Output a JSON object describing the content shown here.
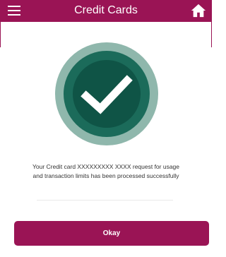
{
  "header": {
    "title": "Credit Cards",
    "menu_icon": "hamburger-menu-icon",
    "home_icon": "home-icon"
  },
  "result": {
    "icon": "checkmark-icon",
    "message": "Your Credit card XXXXXXXXX XXXX request for usage and transaction limits has been processed successfully"
  },
  "actions": {
    "okay_label": "Okay"
  },
  "colors": {
    "brand": "#9a1455",
    "badge_outer": "#8fb7ac",
    "badge_inner": "#1b6b5a",
    "badge_center": "#0f5446"
  }
}
